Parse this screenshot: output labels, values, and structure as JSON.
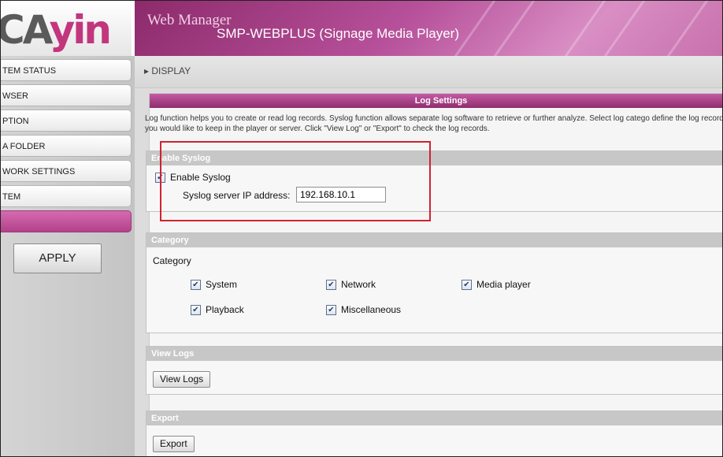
{
  "logo": {
    "text_left": "CA",
    "text_right": "yin"
  },
  "header": {
    "title": "Web Manager",
    "subtitle": "SMP-WEBPLUS (Signage Media Player)"
  },
  "sidebar": {
    "items": [
      {
        "label": "TEM STATUS"
      },
      {
        "label": "WSER"
      },
      {
        "label": "PTION"
      },
      {
        "label": "A FOLDER"
      },
      {
        "label": "WORK SETTINGS"
      },
      {
        "label": "TEM"
      },
      {
        "label": ""
      }
    ],
    "apply_label": "APPLY"
  },
  "breadcrumb": {
    "text": "▸ DISPLAY"
  },
  "panel": {
    "title": "Log Settings",
    "description": "Log function helps you to create or read log records. Syslog function allows separate log software to retrieve or further analyze. Select log catego define the log records you would like to keep in the player or server. Click \"View Log\" or \"Export\" to check the log records."
  },
  "syslog": {
    "heading": "Enable Syslog",
    "enable_label": "Enable Syslog",
    "enabled": true,
    "ip_label": "Syslog server IP address:",
    "ip_value": "192.168.10.1"
  },
  "category": {
    "heading": "Category",
    "label": "Category",
    "items": [
      {
        "label": "System",
        "checked": true
      },
      {
        "label": "Network",
        "checked": true
      },
      {
        "label": "Media player",
        "checked": true
      },
      {
        "label": "Playback",
        "checked": true
      },
      {
        "label": "Miscellaneous",
        "checked": true
      }
    ]
  },
  "view_logs": {
    "heading": "View Logs",
    "button_label": "View Logs"
  },
  "export": {
    "heading": "Export",
    "button_label": "Export"
  },
  "colors": {
    "accent": "#b2418a",
    "highlight_box": "#cf2233"
  }
}
